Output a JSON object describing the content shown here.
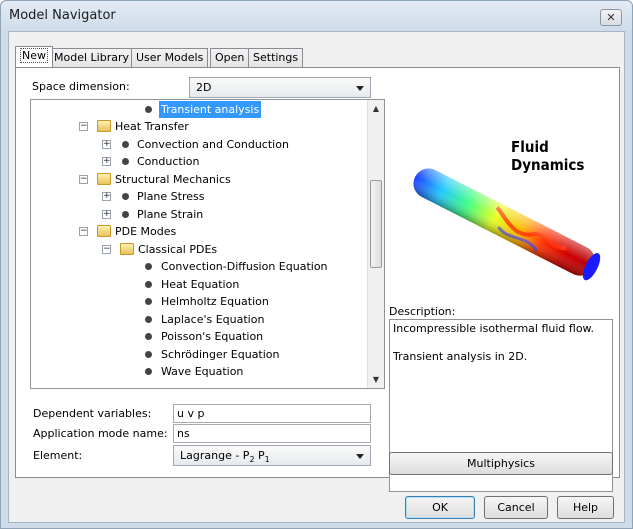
{
  "window": {
    "title": "Model Navigator"
  },
  "tabs": [
    {
      "label": "New"
    },
    {
      "label": "Model Library"
    },
    {
      "label": "User Models"
    },
    {
      "label": "Open"
    },
    {
      "label": "Settings"
    }
  ],
  "space_dimension": {
    "label": "Space dimension:",
    "value": "2D"
  },
  "tree": {
    "items": [
      {
        "label": "Transient analysis",
        "selected": true
      },
      {
        "label": "Heat Transfer"
      },
      {
        "label": "Convection and Conduction"
      },
      {
        "label": "Conduction"
      },
      {
        "label": "Structural Mechanics"
      },
      {
        "label": "Plane Stress"
      },
      {
        "label": "Plane Strain"
      },
      {
        "label": "PDE Modes"
      },
      {
        "label": "Classical PDEs"
      },
      {
        "label": "Convection-Diffusion Equation"
      },
      {
        "label": "Heat Equation"
      },
      {
        "label": "Helmholtz Equation"
      },
      {
        "label": "Laplace's Equation"
      },
      {
        "label": "Poisson's Equation"
      },
      {
        "label": "Schrödinger Equation"
      },
      {
        "label": "Wave Equation"
      }
    ]
  },
  "preview": {
    "title": "Fluid Dynamics"
  },
  "description": {
    "label": "Description:",
    "line1": "Incompressible isothermal fluid flow.",
    "line2": "Transient analysis in 2D."
  },
  "fields": {
    "dependent_variables": {
      "label": "Dependent variables:",
      "value": "u v p"
    },
    "application_mode_name": {
      "label": "Application mode name:",
      "value": "ns"
    },
    "element": {
      "label": "Element:",
      "value_base": "Lagrange - P",
      "sub1": "2",
      "mid": " P",
      "sub2": "1"
    }
  },
  "buttons": {
    "multiphysics": "Multiphysics",
    "ok": "OK",
    "cancel": "Cancel",
    "help": "Help"
  },
  "close_glyph": "✕"
}
